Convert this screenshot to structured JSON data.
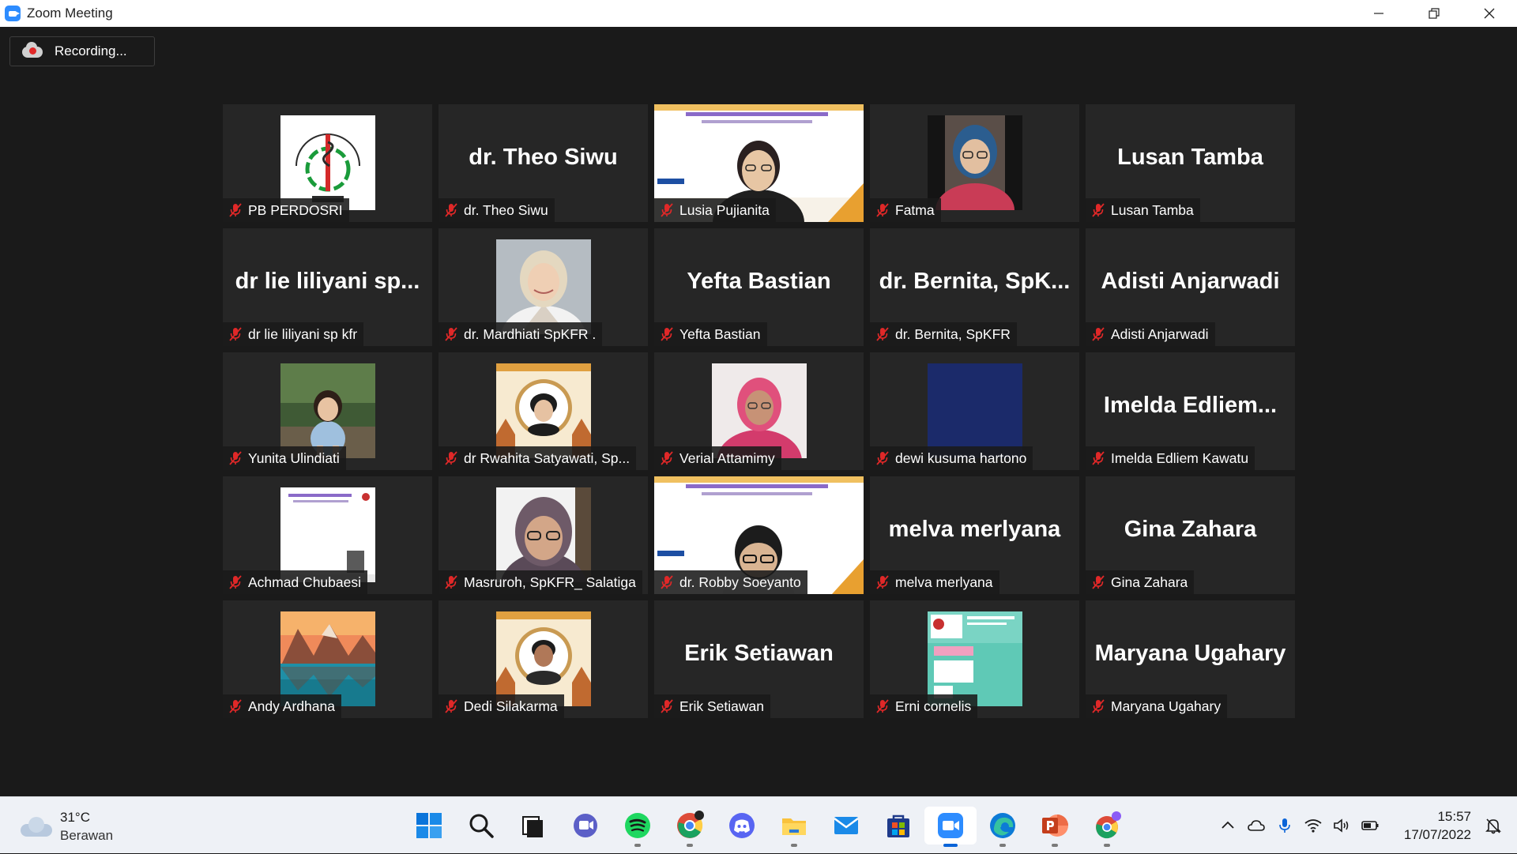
{
  "window": {
    "title": "Zoom Meeting",
    "recording_label": "Recording..."
  },
  "participants": [
    {
      "name": "PB PERDOSRI",
      "display": "",
      "type": "image",
      "image": "logo"
    },
    {
      "name": "dr. Theo Siwu",
      "display": "dr. Theo Siwu",
      "type": "name"
    },
    {
      "name": "Lusia Pujianita",
      "display": "",
      "type": "image",
      "image": "slide-woman"
    },
    {
      "name": "Fatma",
      "display": "",
      "type": "image",
      "image": "woman-hijab-pink"
    },
    {
      "name": "Lusan Tamba",
      "display": "Lusan Tamba",
      "type": "name"
    },
    {
      "name": "dr lie liliyani sp kfr",
      "display": "dr lie liliyani sp...",
      "type": "name"
    },
    {
      "name": "dr. Mardhiati SpKFR .",
      "display": "",
      "type": "image",
      "image": "doctor-hijab"
    },
    {
      "name": "Yefta Bastian",
      "display": "Yefta Bastian",
      "type": "name"
    },
    {
      "name": "dr. Bernita, SpKFR",
      "display": "dr. Bernita, SpK...",
      "type": "name"
    },
    {
      "name": "Adisti Anjarwadi",
      "display": "Adisti Anjarwadi",
      "type": "name"
    },
    {
      "name": "Yunita Ulindiati",
      "display": "",
      "type": "image",
      "image": "child-garden"
    },
    {
      "name": "dr Rwahita Satyawati, Sp...",
      "display": "",
      "type": "image",
      "image": "portrait-frame"
    },
    {
      "name": "Verial Attamimy",
      "display": "",
      "type": "image",
      "image": "woman-pink-hijab"
    },
    {
      "name": "dewi kusuma hartono",
      "display": "",
      "type": "image",
      "image": "blue-blank"
    },
    {
      "name": "Imelda Edliem Kawatu",
      "display": "Imelda  Edliem...",
      "type": "name"
    },
    {
      "name": "Achmad Chubaesi",
      "display": "",
      "type": "image",
      "image": "slide-small"
    },
    {
      "name": "Masruroh, SpKFR_ Salatiga",
      "display": "",
      "type": "image",
      "image": "woman-glasses"
    },
    {
      "name": "dr. Robby Soeyanto",
      "display": "",
      "type": "image",
      "image": "slide-man"
    },
    {
      "name": "melva merlyana",
      "display": "melva merlyana",
      "type": "name"
    },
    {
      "name": "Gina Zahara",
      "display": "Gina Zahara",
      "type": "name"
    },
    {
      "name": "Andy Ardhana",
      "display": "",
      "type": "image",
      "image": "mountain-lake"
    },
    {
      "name": "Dedi Silakarma",
      "display": "",
      "type": "image",
      "image": "portrait-frame-man"
    },
    {
      "name": "Erik Setiawan",
      "display": "Erik Setiawan",
      "type": "name"
    },
    {
      "name": "Erni cornelis",
      "display": "",
      "type": "image",
      "image": "conference-poster"
    },
    {
      "name": "Maryana Ugahary",
      "display": "Maryana Ugahary",
      "type": "name"
    }
  ],
  "taskbar": {
    "weather_temp": "31°C",
    "weather_desc": "Berawan",
    "time": "15:57",
    "date": "17/07/2022",
    "apps": [
      "windows-start-icon",
      "search-icon",
      "task-view-icon",
      "teams-chat-icon",
      "spotify-icon",
      "chrome-icon",
      "discord-icon",
      "file-explorer-icon",
      "mail-icon",
      "microsoft-store-icon",
      "zoom-icon",
      "edge-icon",
      "powerpoint-icon",
      "chrome-profile-icon"
    ]
  },
  "colors": {
    "meeting_bg": "#1a1a1a",
    "tile_bg": "#262626",
    "mute_red": "#e02828",
    "zoom_blue": "#2D8CFF"
  }
}
